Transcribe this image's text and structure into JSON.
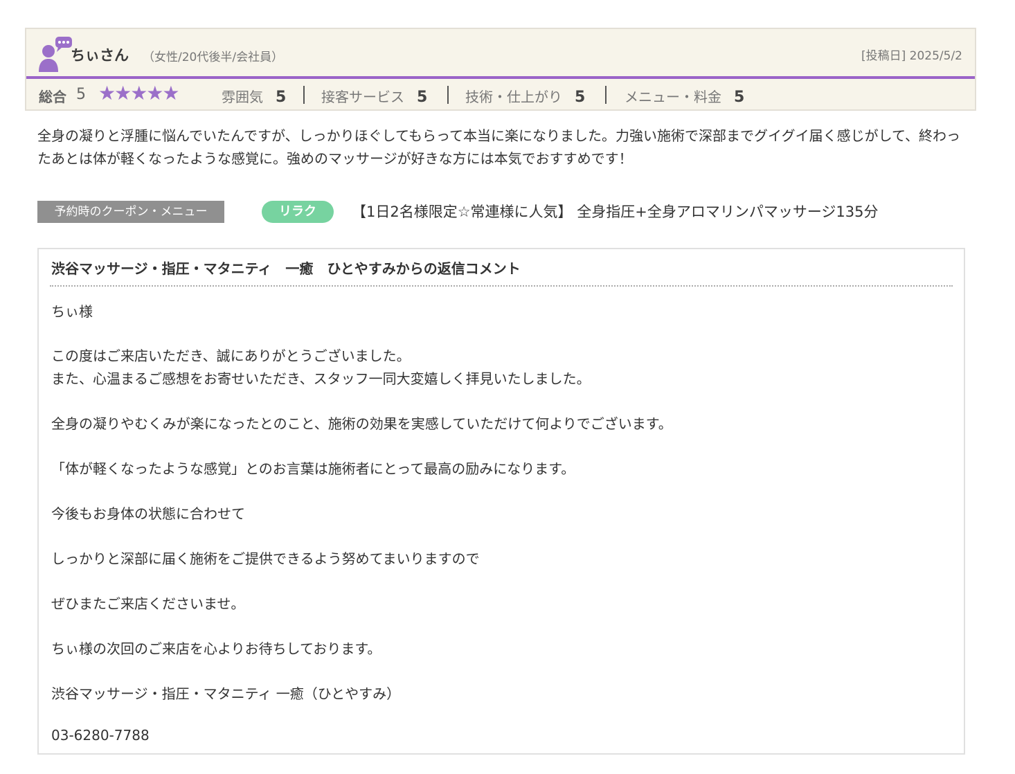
{
  "reviewer": {
    "name": "ちぃさん",
    "meta": "（女性/20代後半/会社員）",
    "post_date": "[投稿日] 2025/5/2"
  },
  "ratings": {
    "overall_label": "総合",
    "overall_value": "5",
    "stars": "★★★★★",
    "star_count": 5,
    "accent_color": "#9b6fc9",
    "items": [
      {
        "label": "雰囲気",
        "value": "5"
      },
      {
        "label": "接客サービス",
        "value": "5"
      },
      {
        "label": "技術・仕上がり",
        "value": "5"
      },
      {
        "label": "メニュー・料金",
        "value": "5"
      }
    ]
  },
  "review_text": "全身の凝りと浮腫に悩んでいたんですが、しっかりほぐしてもらって本当に楽になりました。力強い施術で深部までグイグイ届く感じがして、終わったあとは体が軽くなったような感覚に。強めのマッサージが好きな方には本気でおすすめです！",
  "coupon": {
    "label": "予約時のクーポン・メニュー",
    "category": "リラク",
    "menu": "【1日2名様限定☆常連様に人気】 全身指圧+全身アロマリンパマッサージ135分"
  },
  "reply": {
    "title": "渋谷マッサージ・指圧・マタニティ　一癒　ひとやすみからの返信コメント",
    "lines": [
      "ちぃ様",
      "この度はご来店いただき、誠にありがとうございました。",
      "また、心温まるご感想をお寄せいただき、スタッフ一同大変嬉しく拝見いたしました。",
      "全身の凝りやむくみが楽になったとのこと、施術の効果を実感していただけて何よりでございます。",
      "「体が軽くなったような感覚」とのお言葉は施術者にとって最高の励みになります。",
      "今後もお身体の状態に合わせて",
      "しっかりと深部に届く施術をご提供できるよう努めてまいりますので",
      "ぜひまたご来店くださいませ。",
      "ちぃ様の次回のご来店を心よりお待ちしております。",
      "渋谷マッサージ・指圧・マタニティ 一癒（ひとやすみ）",
      "03-6280-7788"
    ]
  }
}
